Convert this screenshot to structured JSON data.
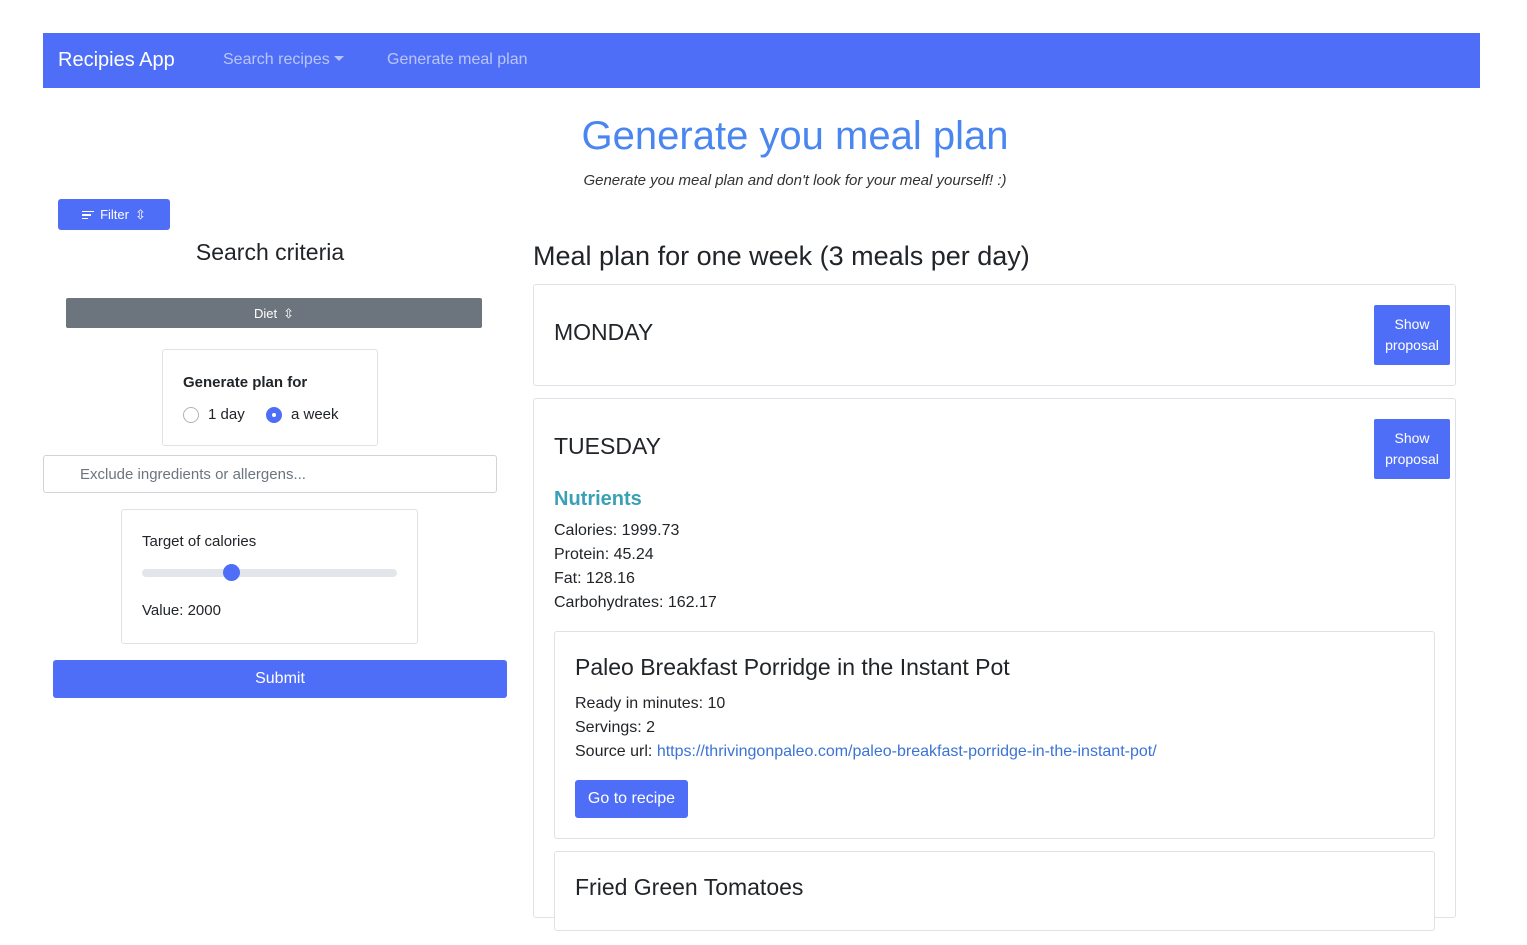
{
  "navbar": {
    "brand": "Recipies App",
    "search_label": "Search recipes",
    "generate_label": "Generate meal plan"
  },
  "header": {
    "title": "Generate you meal plan",
    "subtitle": "Generate you meal plan and don't look for your meal yourself! :)"
  },
  "sidebar": {
    "filter_label": "Filter",
    "search_criteria": "Search criteria",
    "diet_label": "Diet",
    "plan_for": {
      "label": "Generate plan for",
      "options": [
        "1 day",
        "a week"
      ],
      "selected": "a week"
    },
    "exclude_placeholder": "Exclude ingredients or allergens...",
    "calories": {
      "label": "Target of calories",
      "value_text": "Value: 2000",
      "slider_fraction": 0.35
    },
    "submit_label": "Submit"
  },
  "plan": {
    "heading": "Meal plan for one week (3 meals per day)",
    "show_proposal_label": "Show proposal",
    "days": [
      {
        "name": "MONDAY"
      },
      {
        "name": "TUESDAY",
        "nutrients_title": "Nutrients",
        "nutrients": [
          "Calories: 1999.73",
          "Protein: 45.24",
          "Fat: 128.16",
          "Carbohydrates: 162.17"
        ],
        "recipes": [
          {
            "title": "Paleo Breakfast Porridge in the Instant Pot",
            "ready": "Ready in minutes: 10",
            "servings": "Servings: 2",
            "source_prefix": "Source url:",
            "source_url": "https://thrivingonpaleo.com/paleo-breakfast-porridge-in-the-instant-pot/",
            "button": "Go to recipe"
          },
          {
            "title": "Fried Green Tomatoes"
          }
        ]
      }
    ]
  },
  "colors": {
    "primary": "#4f6ef7",
    "title": "#4a86f0",
    "nutrients": "#3aa0b5",
    "secondary": "#6c757d"
  }
}
